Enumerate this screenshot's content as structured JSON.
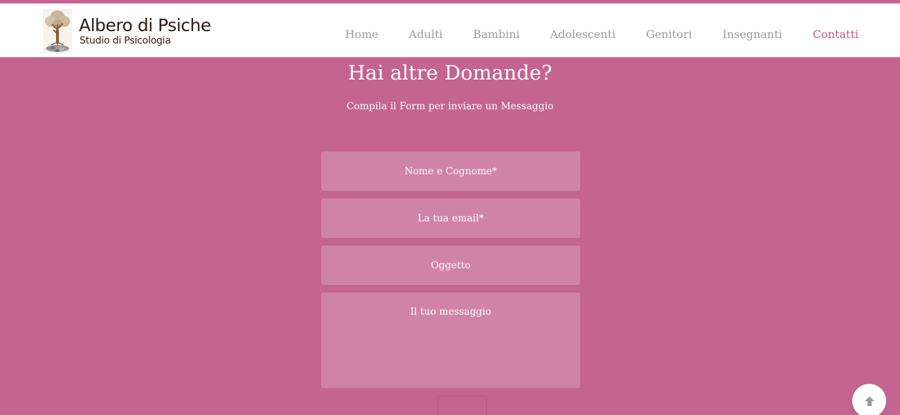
{
  "brand": {
    "title": "Albero di Psiche",
    "subtitle": "Studio di Psicologia",
    "logo_icon": "tree-icon"
  },
  "nav": {
    "items": [
      {
        "label": "Home"
      },
      {
        "label": "Adulti"
      },
      {
        "label": "Bambini"
      },
      {
        "label": "Adolescenti"
      },
      {
        "label": "Genitori"
      },
      {
        "label": "Insegnanti"
      },
      {
        "label": "Contatti",
        "active": true
      }
    ]
  },
  "section": {
    "title": "Hai altre Domande?",
    "subtitle": "Compila il Form per inviare un Messaggio"
  },
  "form": {
    "name_placeholder": "Nome e Cognome*",
    "email_placeholder": "La tua email*",
    "subject_placeholder": "Oggetto",
    "message_placeholder": "Il tuo messaggio"
  },
  "scroll_top": {
    "icon": "arrow-up-icon"
  },
  "colors": {
    "background": "#c46490",
    "field": "#d083a9",
    "nav_text": "#9b9b9b",
    "nav_active": "#c3528a",
    "text_light": "#ffffff"
  }
}
